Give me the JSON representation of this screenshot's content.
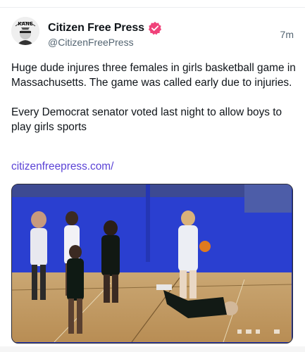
{
  "post": {
    "display_name": "Citizen Free Press",
    "handle": "@CitizenFreePress",
    "time": "7m",
    "avatar_text": "KANE",
    "verified_icon": "verified-badge-icon",
    "paragraphs": [
      "Huge dude injures three females in girls basketball game in Massachusetts. The game was called early due to injuries.",
      "Every Democrat senator voted last night to allow boys to play girls sports"
    ],
    "link": "citizenfreepress.com/"
  },
  "colors": {
    "link": "#5b43d6",
    "verified_badge": "#f0427a",
    "muted_text": "#536471"
  },
  "media": {
    "type": "video",
    "description_icon": "video-player",
    "controls": [
      "volume-icon",
      "captions-icon",
      "fullscreen-icon"
    ]
  }
}
